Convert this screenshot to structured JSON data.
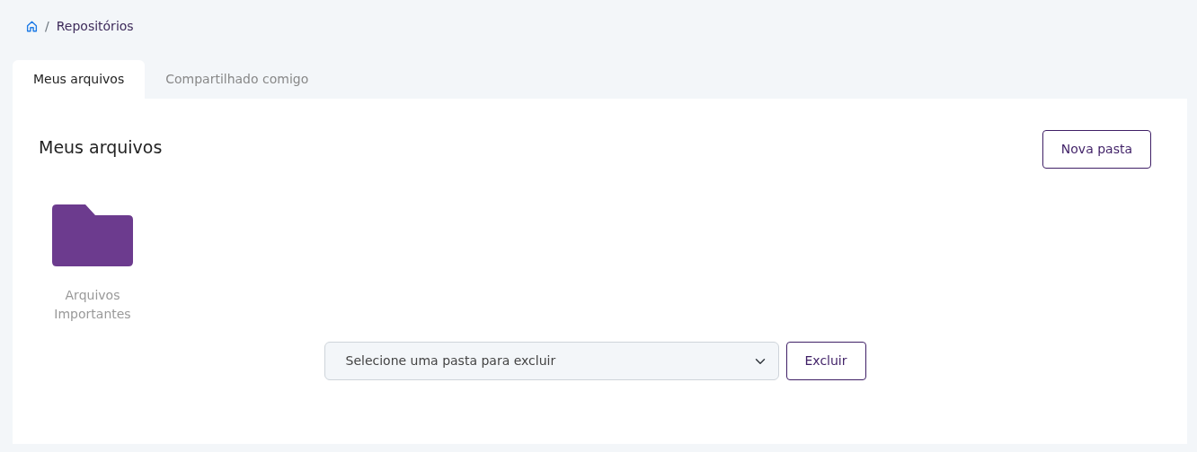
{
  "breadcrumb": {
    "separator": "/",
    "items": [
      "Repositórios"
    ]
  },
  "tabs": [
    {
      "label": "Meus arquivos",
      "selected": true
    },
    {
      "label": "Compartilhado comigo",
      "selected": false
    }
  ],
  "panel": {
    "title": "Meus arquivos",
    "new_folder_button": "Nova pasta",
    "folders": [
      {
        "name": "Arquivos Importantes"
      }
    ],
    "delete_select": {
      "value": "Selecione uma pasta para excluir"
    },
    "delete_button": "Excluir"
  }
}
